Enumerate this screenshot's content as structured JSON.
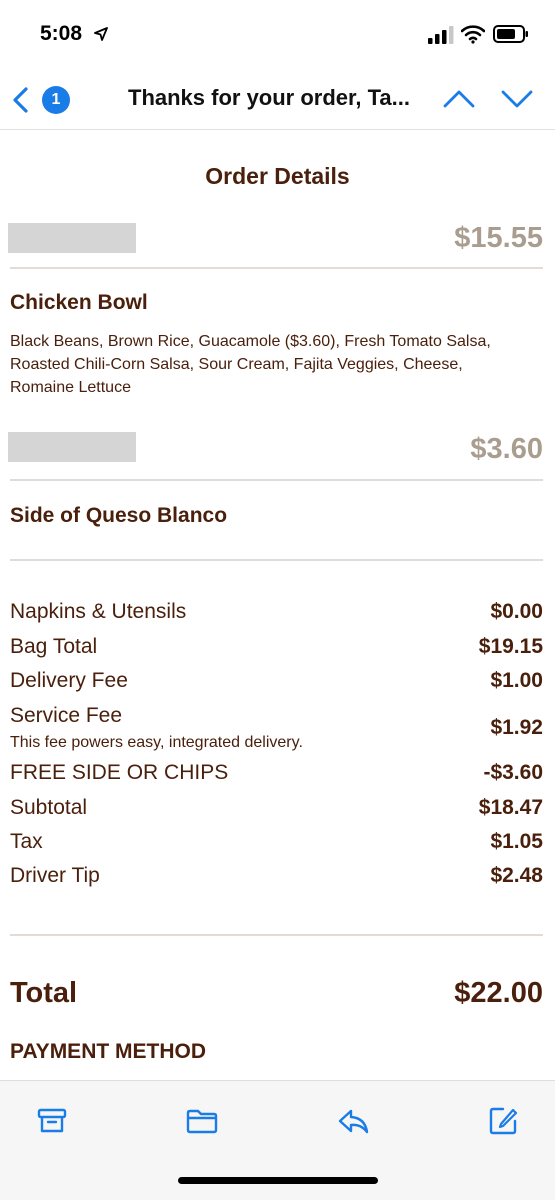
{
  "status_bar": {
    "time": "5:08",
    "icons": [
      "location-arrow-icon",
      "cellular-signal-icon",
      "wifi-icon",
      "battery-icon"
    ]
  },
  "nav": {
    "unread_count": "1",
    "title": "Thanks for your order, Ta...",
    "icons": [
      "back-chevron-icon",
      "previous-message-icon",
      "next-message-icon"
    ]
  },
  "email": {
    "heading": "Order Details",
    "items": [
      {
        "price": "$15.55",
        "name": "Chicken Bowl",
        "description": "Black Beans, Brown Rice, Guacamole ($3.60), Fresh Tomato Salsa, Roasted Chili-Corn Salsa, Sour Cream, Fajita Veggies, Cheese, Romaine Lettuce"
      },
      {
        "price": "$3.60",
        "name": "Side of Queso Blanco"
      }
    ],
    "charges": [
      {
        "label": "Napkins & Utensils",
        "value": "$0.00"
      },
      {
        "label": "Bag Total",
        "value": "$19.15"
      },
      {
        "label": "Delivery Fee",
        "value": "$1.00"
      },
      {
        "label": "Service Fee",
        "value": "$1.92",
        "note": "This fee powers easy, integrated delivery."
      },
      {
        "label": "FREE SIDE OR CHIPS",
        "value": "-$3.60"
      },
      {
        "label": "Subtotal",
        "value": "$18.47"
      },
      {
        "label": "Tax",
        "value": "$1.05"
      },
      {
        "label": "Driver Tip",
        "value": "$2.48"
      }
    ],
    "total_label": "Total",
    "total_value": "$22.00",
    "payment_method_label": "PAYMENT METHOD"
  },
  "toolbar": {
    "icons": [
      "archive-icon",
      "folder-icon",
      "reply-icon",
      "compose-icon"
    ]
  },
  "colors": {
    "accent_blue": "#1a7ce6",
    "text_brown": "#4a200d",
    "price_gray": "#a99d90",
    "divider": "#e3dcd6"
  }
}
